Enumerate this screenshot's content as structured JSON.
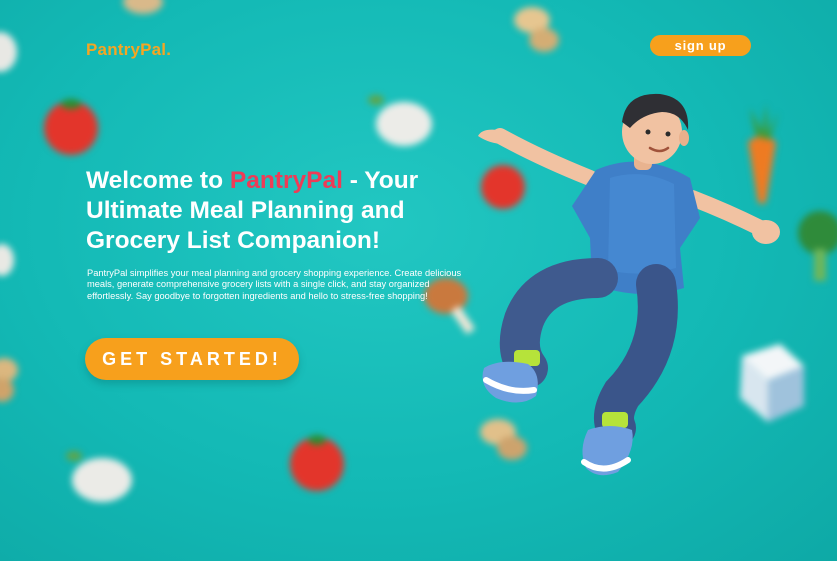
{
  "header": {
    "logo": "PantryPal.",
    "signup_label": "sign up"
  },
  "hero": {
    "title_prefix": "Welcome to ",
    "title_brand": "PantryPal",
    "title_suffix": " - Your Ultimate Meal Planning and Grocery List Companion!",
    "description": "PantryPal simplifies your meal planning and grocery shopping experience. Create delicious meals, generate comprehensive grocery lists with a single click, and stay organized effortlessly. Say goodbye to forgotten ingredients and hello to stress-free shopping!",
    "cta_label": "GET STARTED!"
  },
  "colors": {
    "background": "#13b9b5",
    "accent": "#f7a01c",
    "brand_highlight": "#ee3c57",
    "text": "#ffffff"
  },
  "decorations": [
    "tomato",
    "garlic",
    "carrot",
    "broccoli",
    "chicken-drumstick",
    "milk-carton",
    "mushroom",
    "3d-man-illustration"
  ]
}
